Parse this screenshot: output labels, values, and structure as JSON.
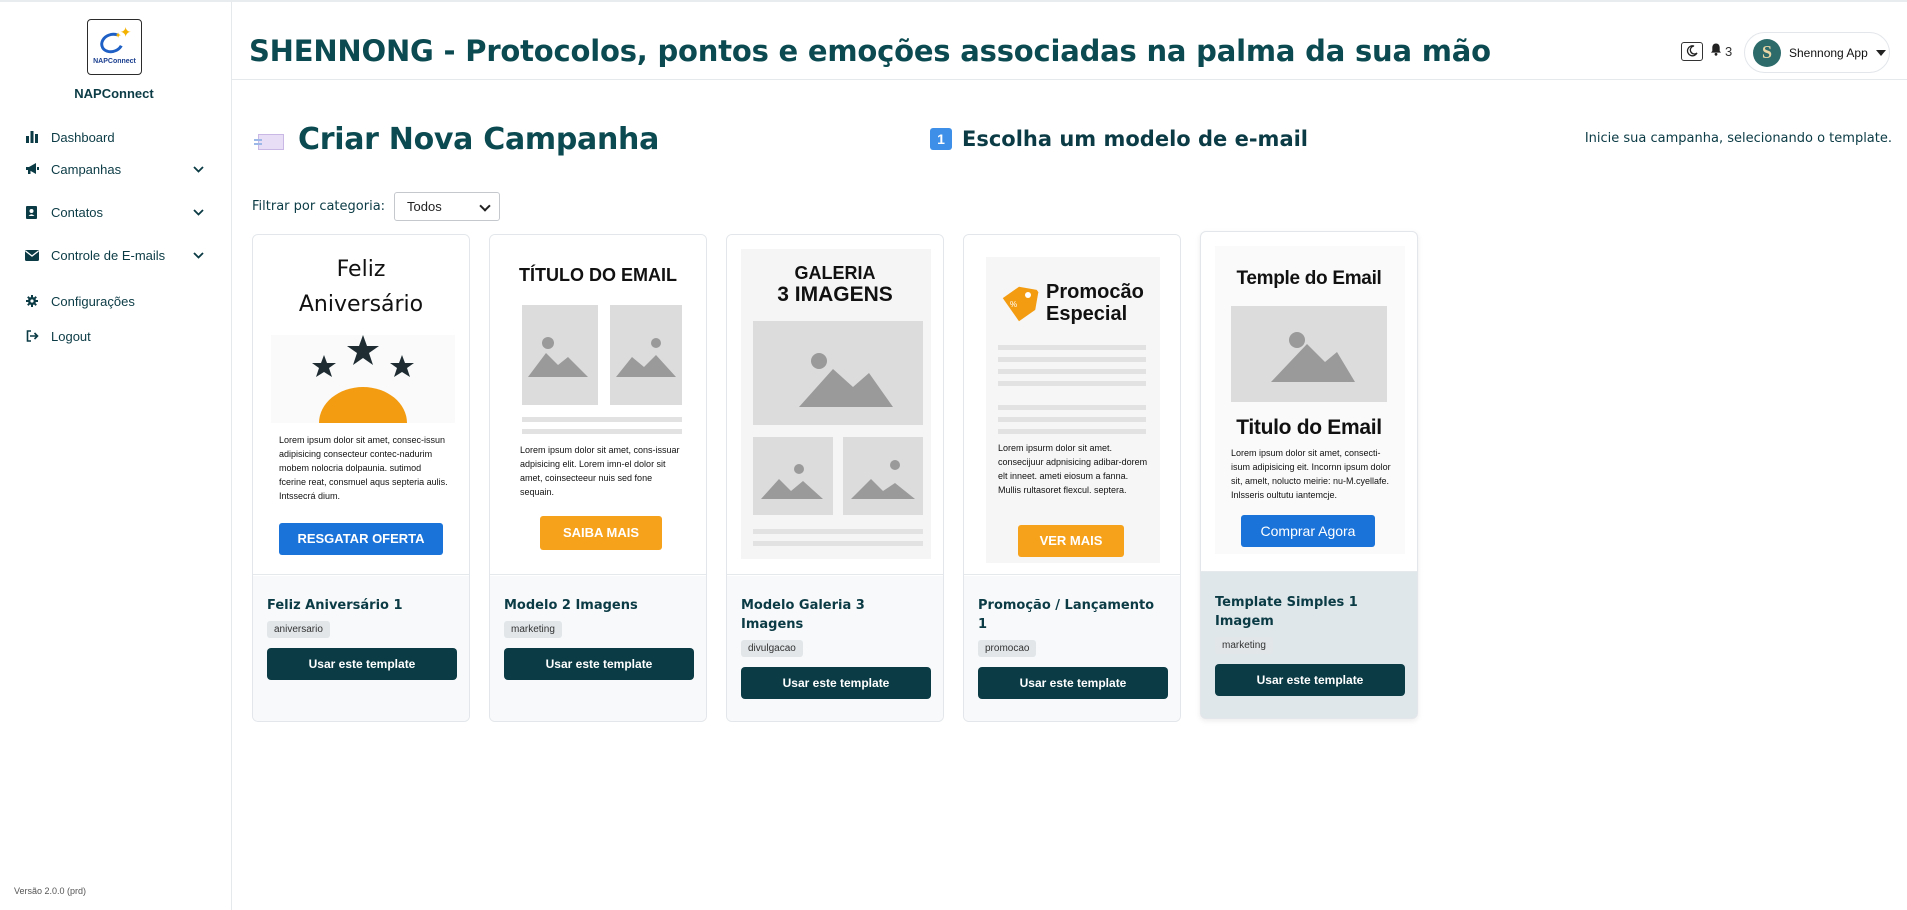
{
  "app": {
    "logo_text": "NAPConnect",
    "brand": "NAPConnect",
    "title": "SHENNONG - Protocolos, pontos e emoções associadas na palma da sua mão",
    "version": "Versão 2.0.0 (prd)"
  },
  "sidebar": {
    "items": [
      {
        "label": "Dashboard",
        "icon": "bar-chart-icon"
      },
      {
        "label": "Campanhas",
        "icon": "megaphone-icon",
        "expandable": true
      },
      {
        "label": "Contatos",
        "icon": "address-book-icon",
        "expandable": true
      },
      {
        "label": "Controle de E-mails",
        "icon": "envelope-icon",
        "expandable": true
      },
      {
        "label": "Configurações",
        "icon": "gear-icon"
      },
      {
        "label": "Logout",
        "icon": "logout-icon"
      }
    ]
  },
  "topbar": {
    "notifications_count": "3",
    "user_name": "Shennong App",
    "avatar_letter": "S"
  },
  "page": {
    "create_title": "Criar Nova Campanha",
    "step_number": "1",
    "step_title": "Escolha um modelo de e-mail",
    "hint": "Inicie sua campanha, selecionando o template."
  },
  "filter": {
    "label": "Filtrar por categoria:",
    "selected": "Todos"
  },
  "templates": [
    {
      "name": "Feliz Aniversário 1",
      "tag": "aniversario",
      "button": "Usar este template",
      "preview": {
        "title_line1": "Feliz",
        "title_line2": "Aniversário",
        "body": "Lorem ipsum dolor sit amet, consec-issun adipisicing consecteur contec-nadurim mobem nolocria dolpaunia. sutimod fcerine reat, consmuel aqus septeria aulis. Intssecrá dium.",
        "cta": "RESGATAR OFERTA"
      }
    },
    {
      "name": "Modelo 2 Imagens",
      "tag": "marketing",
      "button": "Usar este template",
      "preview": {
        "title": "TÍTULO DO EMAIL",
        "body": "Lorem ipsum dolor sit amet, cons-issuar adpisicing elit. Lorem imn-el dolor sit amet, coinsecteeur nuis sed fone sequain.",
        "cta": "SAIBA MAIS"
      }
    },
    {
      "name": "Modelo Galeria 3 Imagens",
      "tag": "divulgacao",
      "button": "Usar este template",
      "preview": {
        "title_line1": "GALERIA",
        "title_line2": "3 IMAGENS"
      }
    },
    {
      "name": "Promoção / Lançamento 1",
      "tag": "promocao",
      "button": "Usar este template",
      "preview": {
        "title_line1": "Promocão",
        "title_line2": "Especial",
        "body": "Lorem ipsurm dolor sit amet. consecijuur adpnisicing adibar-dorem elt inneet. ameti eiosum a fanna. Mullis rultasoret flexcul. septera.",
        "cta": "VER MAIS"
      }
    },
    {
      "name": "Template Simples 1 Imagem",
      "tag": "marketing",
      "button": "Usar este template",
      "preview": {
        "title": "Temple do Email",
        "subtitle": "Titulo do Email",
        "body": "Lorem ipsum dolor sit amet, consecti-isum adipisicing eit. Incornn ipsum dolor sit, amelt, nolucto meirie: nu-M.cyellafe. Inlsseris oultutu iantemcje.",
        "cta": "Comprar Agora"
      }
    }
  ],
  "colors": {
    "primary_dark": "#0b3b45",
    "blue_cta": "#1a73d9",
    "orange_cta": "#f7a21b",
    "sun_orange": "#f39c12"
  }
}
